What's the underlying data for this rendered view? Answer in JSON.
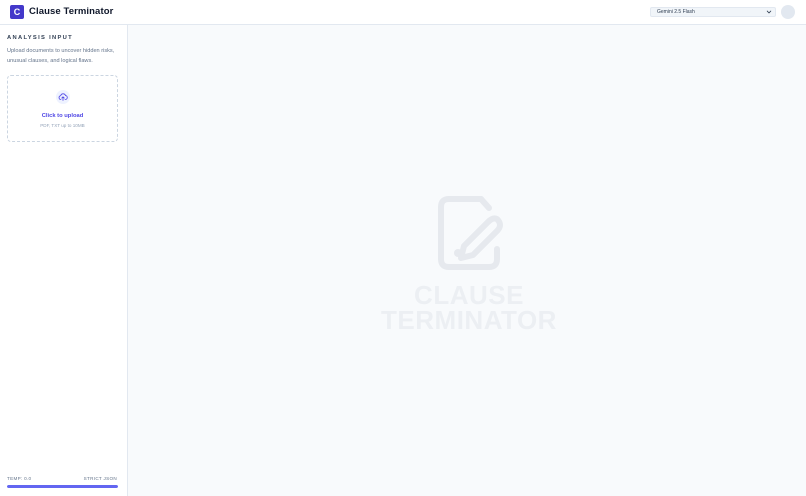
{
  "header": {
    "logo_letter": "C",
    "title": "Clause Terminator",
    "model_select": {
      "selected": "Gemini 2.5 Flash"
    }
  },
  "sidebar": {
    "section_title": "ANALYSIS INPUT",
    "description": "Upload documents to uncover hidden risks, unusual clauses, and logical flaws.",
    "upload": {
      "title": "Click to upload",
      "hint": "PDF, TXT up to 10MB"
    },
    "footer": {
      "temp_label": "TEMP: 0.0",
      "mode_label": "STRICT JSON",
      "progress": 1.0
    }
  },
  "main": {
    "watermark_line1": "CLAUSE",
    "watermark_line2": "TERMINATOR"
  },
  "colors": {
    "accent": "#4f46e5",
    "logo_bg": "#4338ca",
    "progress": "#6366f1"
  },
  "icons": {
    "upload": "cloud-upload-icon",
    "chevron": "chevron-down-icon",
    "watermark": "edit-document-icon"
  }
}
